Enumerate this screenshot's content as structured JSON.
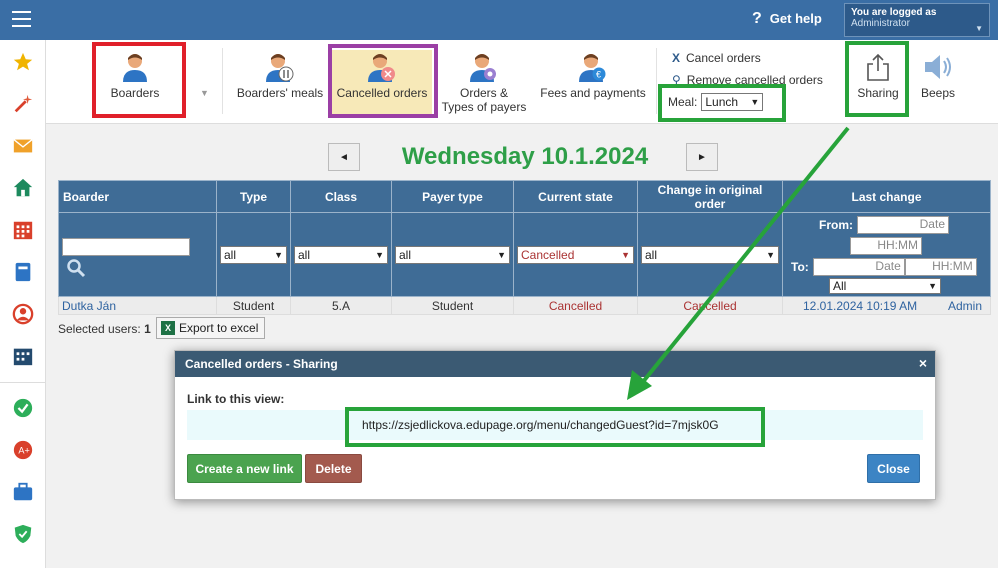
{
  "topbar": {
    "help_label": "Get help",
    "user_line1": "You are logged as",
    "user_line2": "Administrator"
  },
  "sidebar": {
    "icons": [
      "star-icon",
      "wand-icon",
      "mail-icon",
      "home-icon",
      "calendar-grid-icon",
      "book-icon",
      "person-icon",
      "timetable-icon",
      "check-icon",
      "grade-icon",
      "briefcase-icon",
      "shield-icon"
    ]
  },
  "toolbar": {
    "boarders": "Boarders",
    "boarders_meals": "Boarders' meals",
    "cancelled_orders": "Cancelled orders",
    "orders_types_1": "Orders &",
    "orders_types_2": "Types of payers",
    "fees_payments": "Fees and payments",
    "cancel_orders": "Cancel orders",
    "remove_cancelled": "Remove cancelled orders",
    "meal_label": "Meal:",
    "meal_value": "Lunch",
    "sharing": "Sharing",
    "beeps": "Beeps"
  },
  "highlight_colors": {
    "red": "#e0202a",
    "purple": "#9b3fa5",
    "green": "#27a33a"
  },
  "date": {
    "title": "Wednesday 10.1.2024",
    "prev": "◄",
    "next": "►"
  },
  "table": {
    "headers": [
      "Boarder",
      "Type",
      "Class",
      "Payer type",
      "Current state",
      "Change in original order",
      "Last change"
    ],
    "filters": {
      "type": "all",
      "class": "all",
      "payer_type": "all",
      "current_state": "Cancelled",
      "change": "all",
      "from_label": "From:",
      "to_label": "To:",
      "date_placeholder": "Date",
      "time_placeholder": "HH:MM",
      "last_select": "All"
    },
    "rows": [
      {
        "boarder": "Dutka Ján",
        "type": "Student",
        "class": "5.A",
        "payer_type": "Student",
        "current_state": "Cancelled",
        "change": "Cancelled",
        "last_change": "12.01.2024 10:19 AM",
        "by": "Admin"
      }
    ]
  },
  "footer": {
    "selected_label": "Selected users:",
    "selected_count": "1",
    "export": "Export to excel"
  },
  "dialog": {
    "title": "Cancelled orders - Sharing",
    "close": "×",
    "link_label": "Link to this view:",
    "url": "https://zsjedlickova.edupage.org/menu/changedGuest?id=7mjsk0G",
    "create_new": "Create a new link",
    "delete": "Delete",
    "close_btn": "Close"
  }
}
